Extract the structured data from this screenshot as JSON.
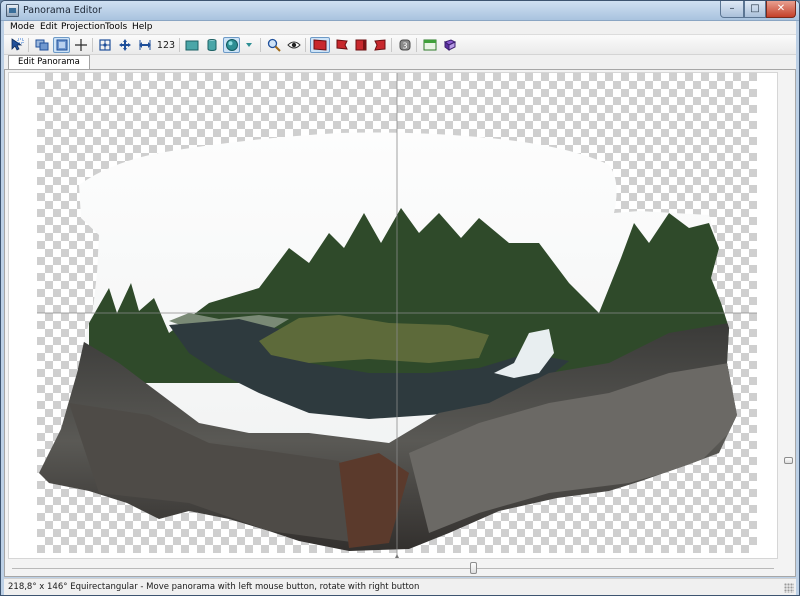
{
  "window": {
    "title": "Panorama Editor"
  },
  "menu": [
    {
      "label": "Mode"
    },
    {
      "label": "Edit"
    },
    {
      "label": "Projection"
    },
    {
      "label": "Tools"
    },
    {
      "label": "Help"
    }
  ],
  "toolbar": {
    "num_label": "123",
    "pressed": [
      "select-images-tool",
      "image-mode"
    ],
    "buttons": [
      "select-arrow-icon",
      "images-icon",
      "image-outline-icon",
      "crosshair-icon",
      "grid-icon",
      "move-icon",
      "stretch-icon",
      "number-123-icon",
      "rectangle-projection-icon",
      "cylinder-projection-icon",
      "sphere-projection-icon",
      "dropdown-icon",
      "zoom-icon",
      "eye-icon",
      "red-rect-icon",
      "red-flag-icon",
      "red-square-icon",
      "red-flag-2-icon",
      "info-3-icon",
      "panels-icon",
      "book-icon"
    ]
  },
  "tabs": [
    {
      "label": "Edit Panorama"
    }
  ],
  "status": {
    "text": "218,8° x 146° Equirectangular - Move panorama with left mouse button, rotate with right button"
  },
  "colors": {
    "sky": "#ffffff",
    "forest": "#2f4a2a",
    "rock": "#4b4a47",
    "water": "#2e3a3e",
    "waterfall": "#e8eef0",
    "titlebar": "#b9d0ea",
    "pressed": "#cde3f7"
  }
}
